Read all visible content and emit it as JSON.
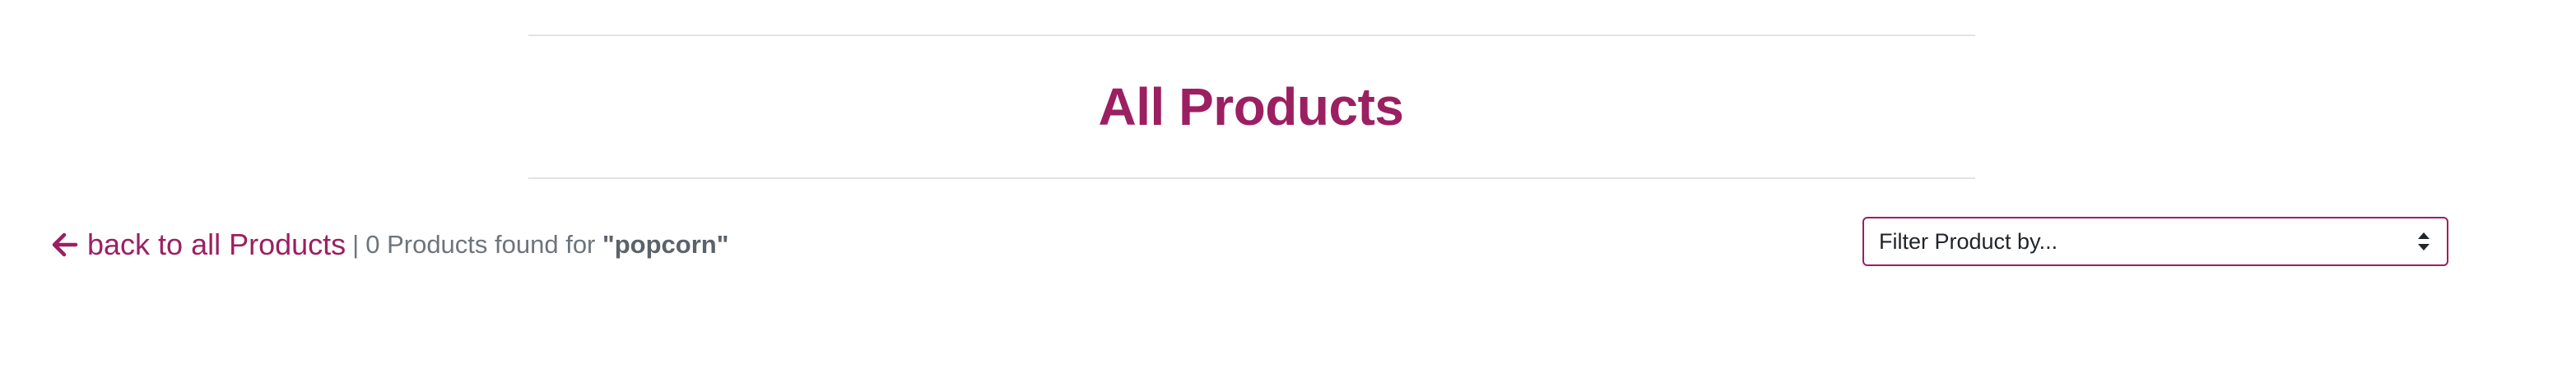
{
  "header": {
    "title": "All Products"
  },
  "results": {
    "back_label": "back to all Products",
    "back_icon": "arrow-left-icon",
    "separator": "|",
    "found_text": "0 Products found for",
    "query": "\"popcorn\""
  },
  "filter": {
    "selected": "Filter Product by...",
    "icon": "sort-caret-icon"
  },
  "colors": {
    "accent": "#9c1f62",
    "muted_text": "#6c757d",
    "divider": "#e3e3e3"
  }
}
